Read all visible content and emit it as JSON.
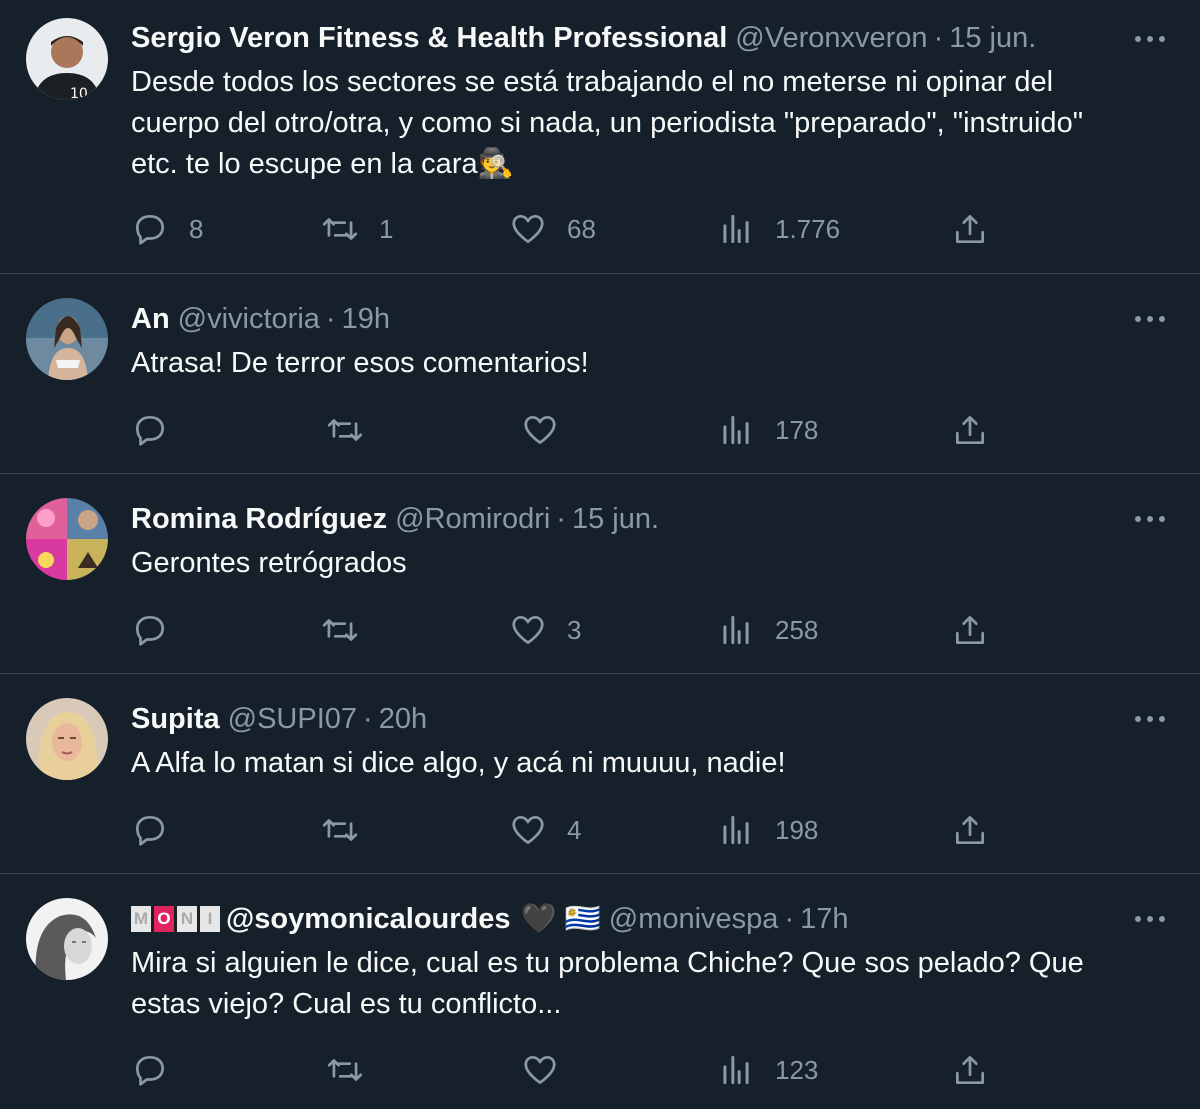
{
  "tweets": [
    {
      "name": "Sergio Veron Fitness & Health Professional",
      "handle": "@Veronxveron",
      "sep": "·",
      "time": "15 jun.",
      "lines": [
        "Desde todos los sectores se está trabajando el no meterse ni opinar del",
        "cuerpo del otro/otra, y como si nada, un periodista \"preparado\", \"instruido\"",
        "etc. te lo escupe en la cara🕵️"
      ],
      "replies": "8",
      "retweets": "1",
      "likes": "68",
      "views": "1.776"
    },
    {
      "name": "An",
      "handle": "@vivictoria",
      "sep": "·",
      "time": "19h",
      "lines": [
        "Atrasa! De terror esos comentarios!"
      ],
      "replies": "",
      "retweets": "",
      "likes": "",
      "views": "178"
    },
    {
      "name": "Romina Rodríguez",
      "handle": "@Romirodri",
      "sep": "·",
      "time": "15 jun.",
      "lines": [
        "Gerontes retrógrados"
      ],
      "replies": "",
      "retweets": "",
      "likes": "3",
      "views": "258"
    },
    {
      "name": "Supita",
      "handle": "@SUPI07",
      "sep": "·",
      "time": "20h",
      "lines": [
        "A Alfa lo matan si dice algo, y acá ni muuuu, nadie!"
      ],
      "replies": "",
      "retweets": "",
      "likes": "4",
      "views": "198"
    },
    {
      "name_badge": [
        "M",
        "O",
        "N",
        "I"
      ],
      "name": "@soymonicalourdes",
      "name_emoji": "🖤",
      "name_flag": "🇺🇾",
      "handle": "@monivespa",
      "sep": "·",
      "time": "17h",
      "lines": [
        "Mira si alguien le dice, cual es tu problema Chiche? Que sos pelado? Que",
        "estas viejo? Cual es tu conflicto..."
      ],
      "replies": "",
      "retweets": "",
      "likes": "",
      "views": "123"
    }
  ],
  "icons": {
    "reply": "reply-icon",
    "retweet": "retweet-icon",
    "like": "heart-icon",
    "views": "views-icon",
    "share": "share-icon",
    "more": "more-icon"
  },
  "colors": {
    "background": "#15202b",
    "text": "#f7f9f9",
    "secondary": "#8b98a5",
    "divider": "#38444d"
  }
}
